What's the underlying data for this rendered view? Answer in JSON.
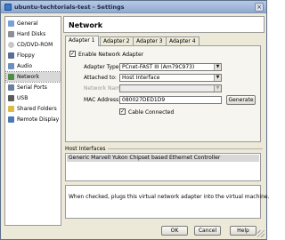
{
  "window": {
    "title": "ubuntu-techtorials-test - Settings",
    "close_glyph": "×"
  },
  "sidebar": {
    "items": [
      {
        "label": "General",
        "icon": "general-icon",
        "color": "#7aa0d8"
      },
      {
        "label": "Hard Disks",
        "icon": "hard-disk-icon",
        "color": "#8a8f99"
      },
      {
        "label": "CD/DVD-ROM",
        "icon": "cd-rom-icon",
        "color": "#c7c7c7"
      },
      {
        "label": "Floppy",
        "icon": "floppy-icon",
        "color": "#5a6e94"
      },
      {
        "label": "Audio",
        "icon": "audio-icon",
        "color": "#6d8fbf"
      },
      {
        "label": "Network",
        "icon": "network-icon",
        "color": "#4e8c4a"
      },
      {
        "label": "Serial Ports",
        "icon": "serial-port-icon",
        "color": "#6b7f9c"
      },
      {
        "label": "USB",
        "icon": "usb-icon",
        "color": "#5b5b5b"
      },
      {
        "label": "Shared Folders",
        "icon": "shared-folder-icon",
        "color": "#e0b84a"
      },
      {
        "label": "Remote Display",
        "icon": "remote-display-icon",
        "color": "#4c78b5"
      }
    ],
    "selected": "Network"
  },
  "header": {
    "title": "Network"
  },
  "tabs": [
    {
      "label": "Adapter 1",
      "active": true
    },
    {
      "label": "Adapter 2",
      "active": false
    },
    {
      "label": "Adapter 3",
      "active": false
    },
    {
      "label": "Adapter 4",
      "active": false
    }
  ],
  "adapter": {
    "enable_label": "Enable Network Adapter",
    "enable_checked": true,
    "adapter_type_label": "Adapter Type:",
    "adapter_type_value": "PCnet-FAST III (Am79C973)",
    "attached_to_label": "Attached to:",
    "attached_to_value": "Host Interface",
    "network_name_label": "Network Name:",
    "network_name_value": "",
    "mac_label": "MAC Address:",
    "mac_value": "080027DED1D9",
    "generate_label": "Generate",
    "cable_label": "Cable Connected",
    "cable_checked": true,
    "check_glyph": "✓"
  },
  "host_interfaces": {
    "title": "Host Interfaces",
    "items": [
      "Generic Marvell Yukon Chipset based Ethernet Controller"
    ]
  },
  "info": {
    "text": "When checked, plugs this virtual network adapter into the virtual machine."
  },
  "footer": {
    "ok_label": "OK",
    "cancel_label": "Cancel",
    "help_label": "Help"
  },
  "arrow_glyph": "▼"
}
